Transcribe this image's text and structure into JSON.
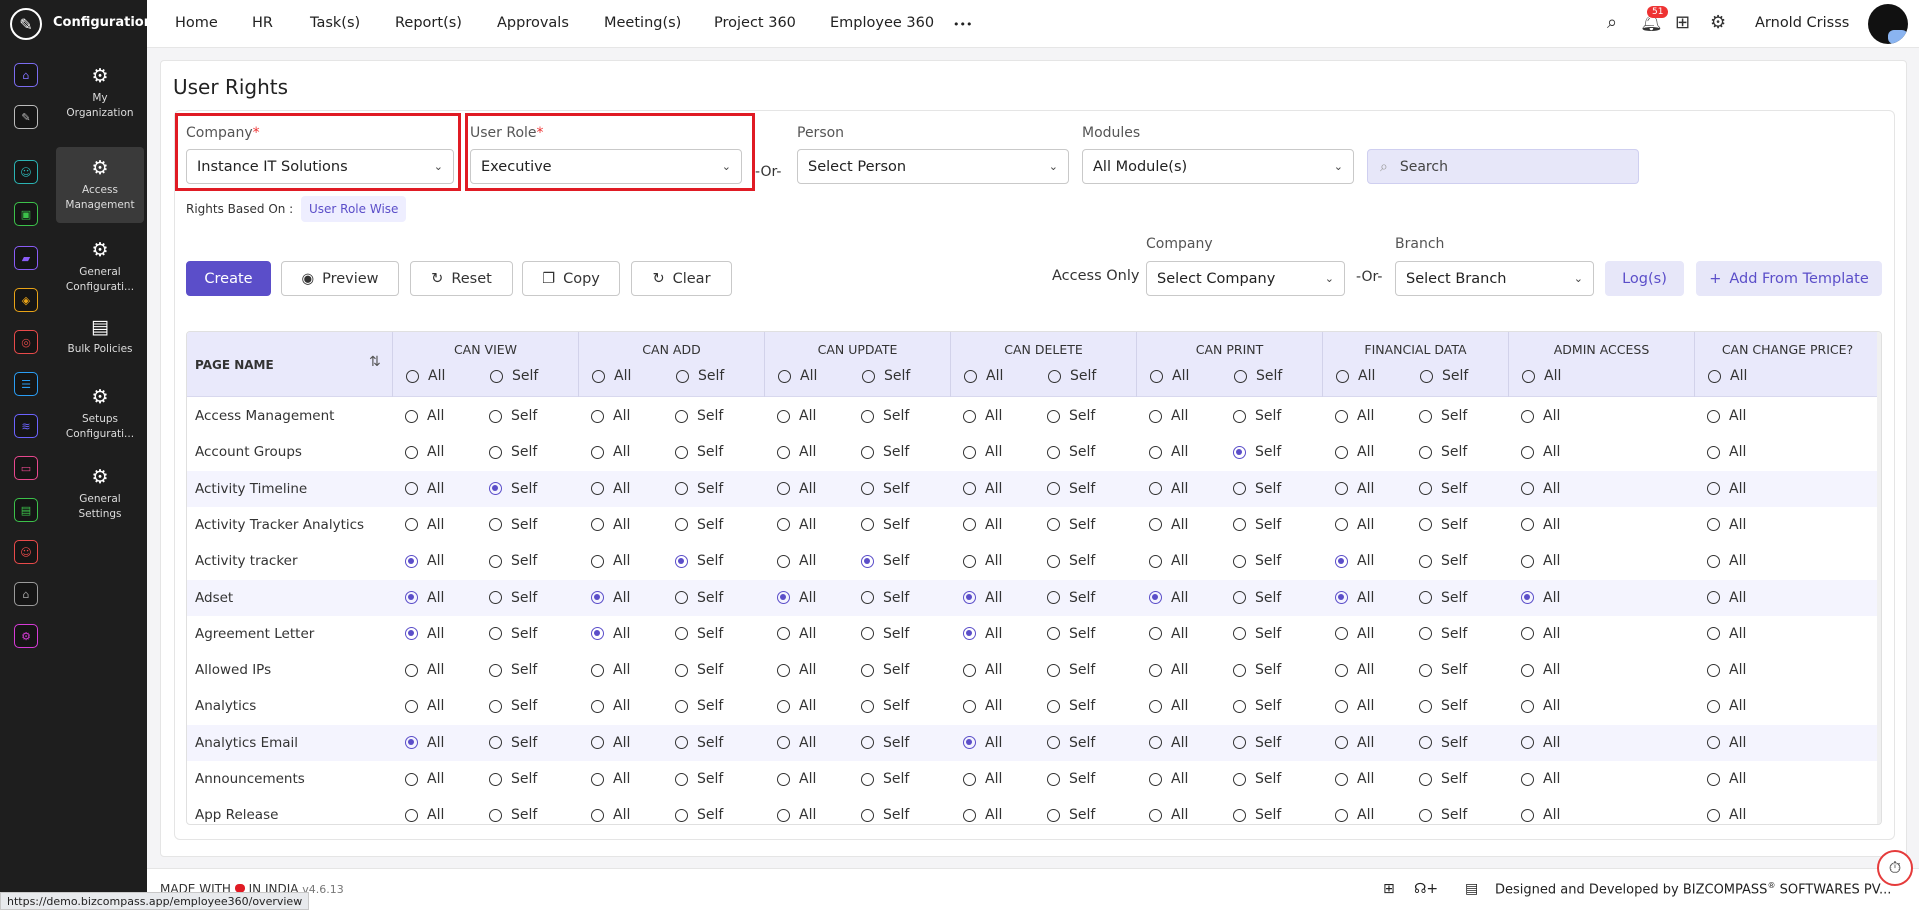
{
  "sidebar": {
    "title": "Configuration",
    "icons": [
      {
        "name": "home-icon",
        "color": "#7b6cf0"
      },
      {
        "name": "pin-icon",
        "color": "#bbbbbb"
      },
      {
        "name": "team-icon",
        "color": "#2bb3b3"
      },
      {
        "name": "box-icon",
        "color": "#3cc14a"
      },
      {
        "name": "briefcase-icon",
        "color": "#8a5cf6"
      },
      {
        "name": "wallet-icon",
        "color": "#e8a317"
      },
      {
        "name": "target-icon",
        "color": "#e84a4a"
      },
      {
        "name": "database-icon",
        "color": "#2a9df4"
      },
      {
        "name": "chart-icon",
        "color": "#6c63ff"
      },
      {
        "name": "monitor-icon",
        "color": "#e8488e"
      },
      {
        "name": "doc-icon",
        "color": "#3cc14a"
      },
      {
        "name": "person-icon",
        "color": "#e84a4a"
      },
      {
        "name": "building-icon",
        "color": "#9a9a9a"
      },
      {
        "name": "settings-icon",
        "color": "#d63bd6"
      }
    ],
    "items": [
      {
        "label": "My Organization"
      },
      {
        "label": "Access Management"
      },
      {
        "label": "General Configurati..."
      },
      {
        "label": "Bulk Policies"
      },
      {
        "label": "Setups Configurati..."
      },
      {
        "label": "General Settings"
      }
    ]
  },
  "topnav": {
    "items": [
      "Home",
      "HR",
      "Task(s)",
      "Report(s)",
      "Approvals",
      "Meeting(s)",
      "Project 360",
      "Employee 360"
    ],
    "more": "•••",
    "notifications": "51",
    "user": "Arnold Crisss"
  },
  "page": {
    "title": "User Rights"
  },
  "filters": {
    "company": {
      "label": "Company",
      "required": "*",
      "value": "Instance IT Solutions"
    },
    "or1": "-Or-",
    "role": {
      "label": "User Role",
      "required": "*",
      "value": "Executive"
    },
    "person": {
      "label": "Person",
      "placeholder": "Select Person"
    },
    "modules": {
      "label": "Modules",
      "value": "All Module(s)"
    },
    "search": {
      "placeholder": "Search"
    },
    "rights_label": "Rights Based On :",
    "rights_value": "User Role Wise"
  },
  "actions": {
    "create": "Create",
    "preview": "Preview",
    "reset": "Reset",
    "copy": "Copy",
    "clear": "Clear",
    "access_only": "Access Only",
    "company_label": "Company",
    "company_placeholder": "Select Company",
    "or2": "-Or-",
    "branch_label": "Branch",
    "branch_placeholder": "Select Branch",
    "logs": "Log(s)",
    "add_template": "Add From Template"
  },
  "table": {
    "page_header": "PAGE NAME",
    "all_label": "All",
    "self_label": "Self",
    "columns": [
      {
        "label": "CAN VIEW",
        "self": true
      },
      {
        "label": "CAN ADD",
        "self": true
      },
      {
        "label": "CAN UPDATE",
        "self": true
      },
      {
        "label": "CAN DELETE",
        "self": true
      },
      {
        "label": "CAN PRINT",
        "self": true
      },
      {
        "label": "FINANCIAL DATA",
        "self": true
      },
      {
        "label": "ADMIN ACCESS",
        "self": false
      },
      {
        "label": "CAN CHANGE PRICE?",
        "self": false
      }
    ],
    "rows": [
      {
        "name": "Access Management",
        "sel": [
          0,
          0,
          0,
          0,
          0,
          0,
          0,
          0
        ]
      },
      {
        "name": "Account Groups",
        "sel": [
          0,
          0,
          0,
          0,
          2,
          0,
          0,
          0
        ]
      },
      {
        "name": "Activity Timeline",
        "sel": [
          2,
          0,
          0,
          0,
          0,
          0,
          0,
          0
        ]
      },
      {
        "name": "Activity Tracker Analytics",
        "sel": [
          0,
          0,
          0,
          0,
          0,
          0,
          0,
          0
        ]
      },
      {
        "name": "Activity tracker",
        "sel": [
          1,
          2,
          2,
          0,
          0,
          1,
          0,
          0
        ]
      },
      {
        "name": "Adset",
        "sel": [
          1,
          1,
          1,
          1,
          1,
          1,
          1,
          0
        ]
      },
      {
        "name": "Agreement Letter",
        "sel": [
          1,
          1,
          0,
          1,
          0,
          0,
          0,
          0
        ]
      },
      {
        "name": "Allowed IPs",
        "sel": [
          0,
          0,
          0,
          0,
          0,
          0,
          0,
          0
        ]
      },
      {
        "name": "Analytics",
        "sel": [
          0,
          0,
          0,
          0,
          0,
          0,
          0,
          0
        ]
      },
      {
        "name": "Analytics Email",
        "sel": [
          1,
          0,
          0,
          1,
          0,
          0,
          0,
          0
        ]
      },
      {
        "name": "Announcements",
        "sel": [
          0,
          0,
          0,
          0,
          0,
          0,
          0,
          0
        ]
      },
      {
        "name": "App Release",
        "sel": [
          0,
          0,
          0,
          0,
          0,
          0,
          0,
          0
        ]
      }
    ]
  },
  "footer": {
    "made_prefix": "MADE WITH",
    "made_suffix": "IN INDIA",
    "version": "v4.6.13",
    "designed": "Designed and Developed by",
    "brand": "BIZCOMPASS",
    "reg": "®",
    "brand_suffix": "SOFTWARES PV...",
    "status_url": "https://demo.bizcompass.app/employee360/overview"
  }
}
